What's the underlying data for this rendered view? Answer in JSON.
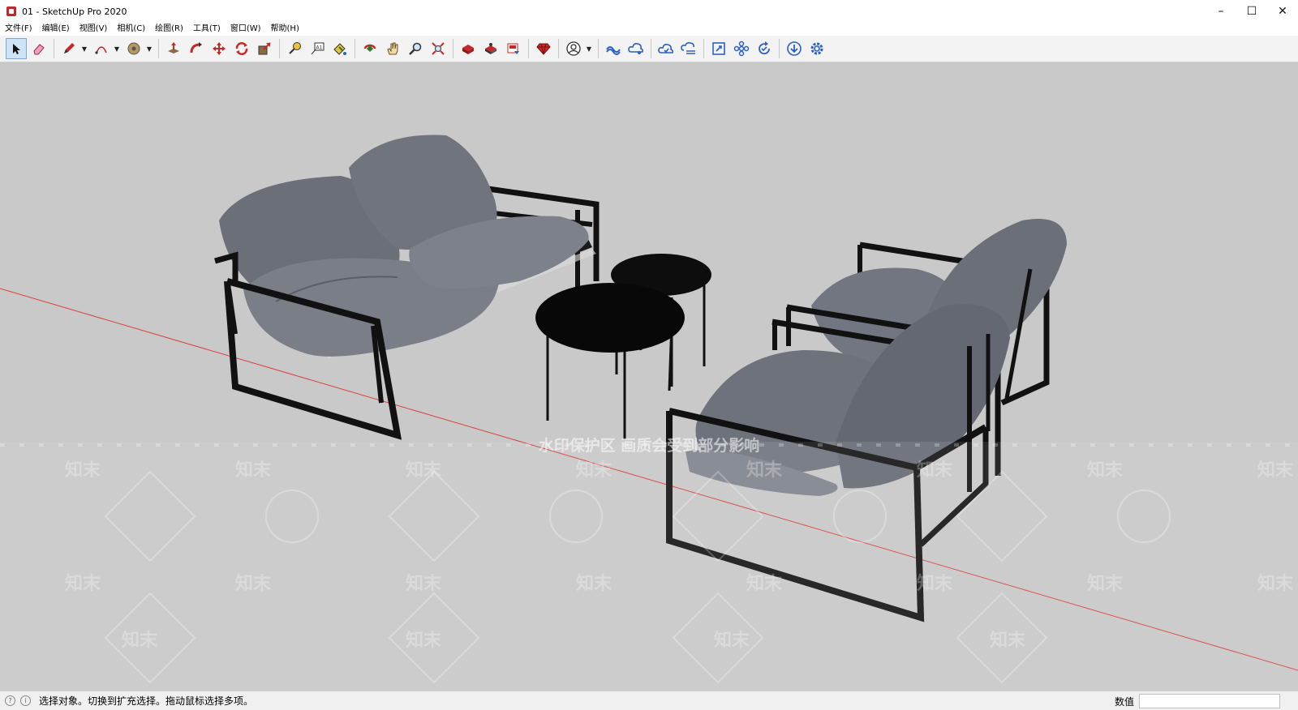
{
  "window": {
    "title": "01 - SketchUp Pro 2020",
    "controls": [
      "minimize-icon",
      "maximize-icon",
      "close-icon"
    ]
  },
  "menu": [
    "文件(F)",
    "编辑(E)",
    "视图(V)",
    "相机(C)",
    "绘图(R)",
    "工具(T)",
    "窗口(W)",
    "帮助(H)"
  ],
  "toolbar": {
    "groups": [
      [
        "select-icon",
        "eraser-icon"
      ],
      [
        "pencil-icon",
        "arc-icon",
        "paint-bucket-icon"
      ],
      [
        "push-pull-icon",
        "follow-me-icon",
        "move-icon",
        "rotate-icon",
        "scale-icon"
      ],
      [
        "tape-measure-icon",
        "text-label-icon",
        "paint-icon"
      ],
      [
        "orbit-icon",
        "pan-icon",
        "zoom-icon",
        "zoom-extents-icon"
      ],
      [
        "3d-warehouse-icon",
        "extension-warehouse-icon",
        "layout-icon"
      ],
      [
        "ruby-console-icon"
      ],
      [
        "account-icon"
      ],
      [
        "trimble-connect-icon",
        "share-icon",
        "cloud-upload-icon",
        "cloud-sync-icon"
      ],
      [
        "fit-view-icon",
        "components-icon",
        "refresh-icon"
      ],
      [
        "import-icon",
        "settings-icon"
      ]
    ]
  },
  "viewport": {
    "watermark_line": "水印保护区   画质会受到部分影响",
    "watermark_tile": "知末"
  },
  "status": {
    "message": "选择对象。切换到扩充选择。拖动鼠标选择多项。",
    "measurement_label": "数值",
    "measurement_value": ""
  },
  "colors": {
    "viewport_bg": "#c9c9c9",
    "red_axis": "#d9403a",
    "cushion": "#6b6f78",
    "frame": "#111111",
    "accent": "#0078d7"
  }
}
